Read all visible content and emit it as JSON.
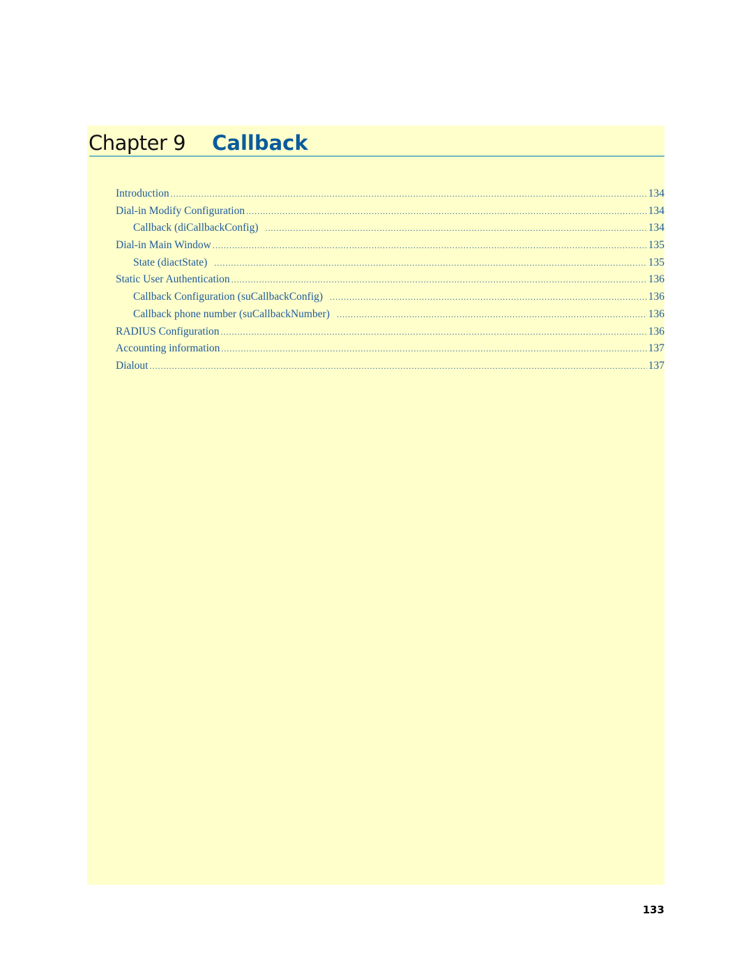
{
  "chapter": {
    "label": "Chapter 9",
    "title": "Callback"
  },
  "toc": [
    {
      "label": "Introduction",
      "page": "134",
      "level": 1
    },
    {
      "label": "Dial-in Modify Configuration",
      "page": "134",
      "level": 1
    },
    {
      "label": "Callback (diCallbackConfig)",
      "page": "134",
      "level": 2
    },
    {
      "label": "Dial-in Main Window",
      "page": "135",
      "level": 1
    },
    {
      "label": "State (diactState)",
      "page": "135",
      "level": 2
    },
    {
      "label": "Static User Authentication",
      "page": "136",
      "level": 1
    },
    {
      "label": "Callback Configuration (suCallbackConfig)",
      "page": "136",
      "level": 2
    },
    {
      "label": "Callback phone number (suCallbackNumber)",
      "page": "136",
      "level": 2
    },
    {
      "label": "RADIUS Configuration",
      "page": "136",
      "level": 1
    },
    {
      "label": "Accounting information",
      "page": "137",
      "level": 1
    },
    {
      "label": "Dialout",
      "page": "137",
      "level": 1
    }
  ],
  "footer": {
    "page_number": "133"
  },
  "colors": {
    "panel_background": "#ffffcc",
    "title_blue": "#0a5b9c",
    "toc_link_blue": "#1d5a9a",
    "rule_teal": "#6fb8c0"
  }
}
